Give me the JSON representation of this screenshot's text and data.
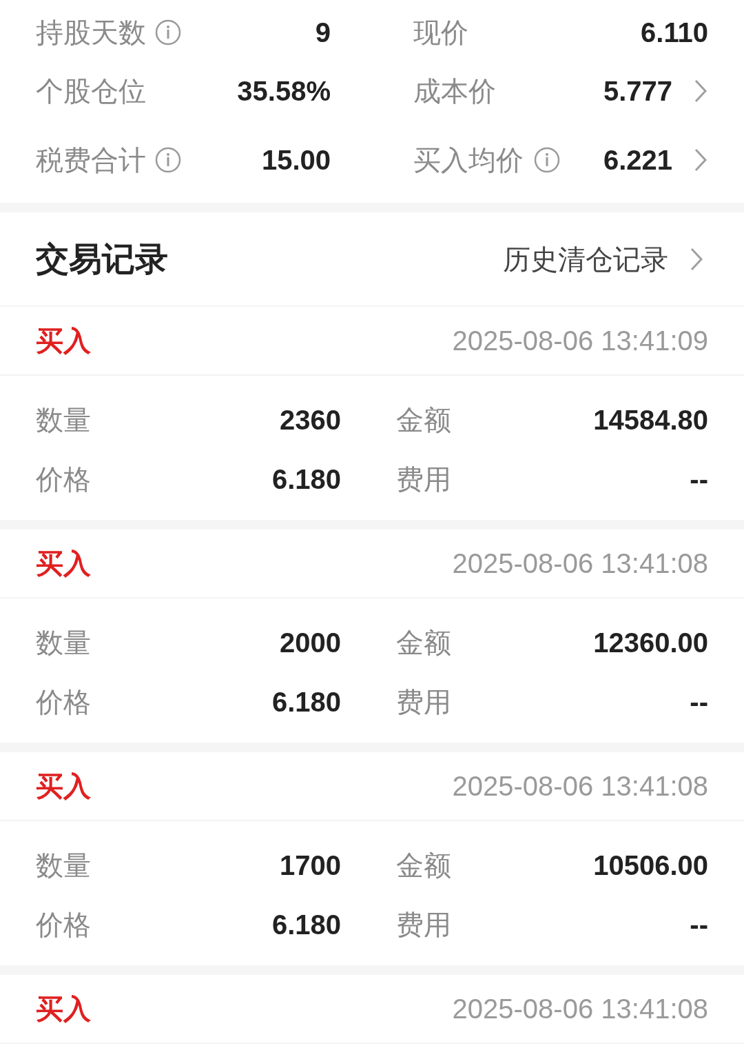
{
  "summary": [
    {
      "left": {
        "label": "持股天数",
        "info": true,
        "value": "9"
      },
      "right": {
        "label": "现价",
        "info": false,
        "value": "6.110",
        "link": false
      }
    },
    {
      "left": {
        "label": "个股仓位",
        "info": false,
        "value": "35.58%"
      },
      "right": {
        "label": "成本价",
        "info": false,
        "value": "5.777",
        "link": true
      }
    },
    {
      "left": {
        "label": "税费合计",
        "info": true,
        "value": "15.00"
      },
      "right": {
        "label": "买入均价",
        "info": true,
        "value": "6.221",
        "link": true
      }
    }
  ],
  "trades": {
    "title": "交易记录",
    "history_link": "历史清仓记录",
    "records": [
      {
        "kind": "buy",
        "type": "买入",
        "time": "2025-08-06 13:41:09",
        "details": [
          {
            "label": "数量",
            "value": "2360"
          },
          {
            "label": "金额",
            "value": "14584.80"
          },
          {
            "label": "价格",
            "value": "6.180"
          },
          {
            "label": "费用",
            "value": "--"
          }
        ]
      },
      {
        "kind": "buy",
        "type": "买入",
        "time": "2025-08-06 13:41:08",
        "details": [
          {
            "label": "数量",
            "value": "2000"
          },
          {
            "label": "金额",
            "value": "12360.00"
          },
          {
            "label": "价格",
            "value": "6.180"
          },
          {
            "label": "费用",
            "value": "--"
          }
        ]
      },
      {
        "kind": "buy",
        "type": "买入",
        "time": "2025-08-06 13:41:08",
        "details": [
          {
            "label": "数量",
            "value": "1700"
          },
          {
            "label": "金额",
            "value": "10506.00"
          },
          {
            "label": "价格",
            "value": "6.180"
          },
          {
            "label": "费用",
            "value": "--"
          }
        ]
      },
      {
        "kind": "buy",
        "type": "买入",
        "time": "2025-08-06 13:41:08"
      }
    ]
  }
}
